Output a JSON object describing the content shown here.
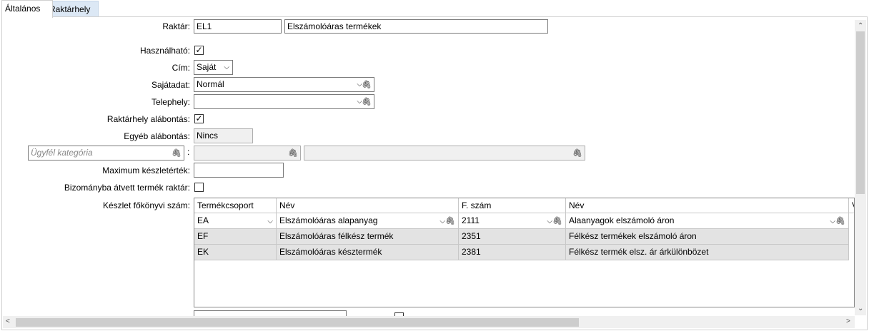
{
  "tabs": {
    "general": "Általános",
    "location": "Raktárhely"
  },
  "form": {
    "raktar_label": "Raktár:",
    "raktar_code": "EL1",
    "raktar_name": "Elszámolóáras termékek",
    "hasznalhato_label": "Használható:",
    "hasznalhato_checked": "✓",
    "cim_label": "Cím:",
    "cim_value": "Saját",
    "sajatadat_label": "Sajátadat:",
    "sajatadat_value": "Normál",
    "telephely_label": "Telephely:",
    "telephely_value": "",
    "raktarhely_label": "Raktárhely alábontás:",
    "raktarhely_checked": "✓",
    "egyeb_label": "Egyéb alábontás:",
    "egyeb_value": "Nincs",
    "ugyfel_placeholder": "Ügyfél kategória",
    "ugyfel_sep": ":",
    "maximum_label": "Maximum készletérték:",
    "maximum_value": "",
    "bizomany_label": "Bizományba átvett termék raktár:",
    "bizomany_checked": "",
    "keszlet_label": "Készlet főkönyvi szám:"
  },
  "grid": {
    "headers": [
      "Termékcsoport",
      "Név",
      "F. szám",
      "Név",
      "V"
    ],
    "rows": [
      [
        "EA",
        "Elszámolóáras alapanyag",
        "2111",
        "Alaanyagok elszámoló áron"
      ],
      [
        "EF",
        "Elszámolóáras félkész termék",
        "2351",
        "Félkész termékek elszámoló áron"
      ],
      [
        "EK",
        "Elszámolóáras késztermék",
        "2381",
        "Félkész termék elsz. ár árkülönbözet"
      ]
    ]
  },
  "icons": {
    "dropdown": "⌵",
    "clip": "🖇",
    "up": "⌃",
    "down": "⌄",
    "left": "<",
    "right": ">"
  }
}
